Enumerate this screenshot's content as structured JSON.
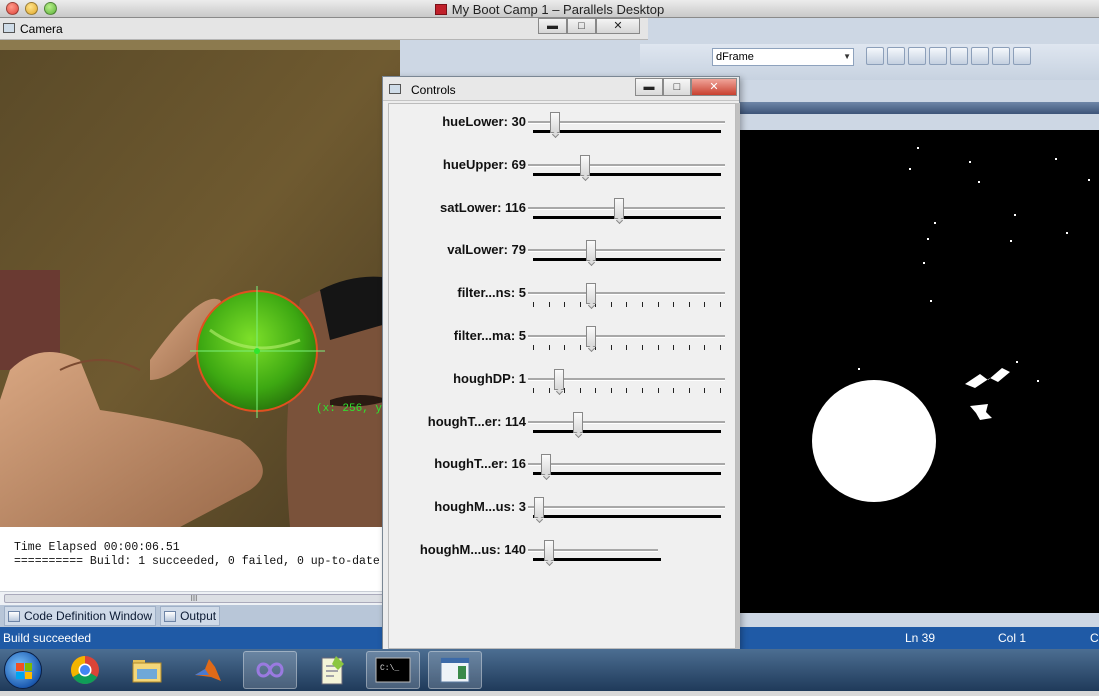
{
  "mac_window": {
    "title": "My Boot Camp 1 – Parallels Desktop"
  },
  "camera_window": {
    "title": "Camera",
    "tracking_label": "(x: 256, y"
  },
  "controls_window": {
    "title": "Controls",
    "trackbars": [
      {
        "label": "hueLower: 30",
        "fraction": 0.12,
        "ticks": false,
        "short": false
      },
      {
        "label": "hueUpper: 69",
        "fraction": 0.28,
        "ticks": false,
        "short": false
      },
      {
        "label": "satLower: 116",
        "fraction": 0.46,
        "ticks": false,
        "short": false
      },
      {
        "label": "valLower: 79",
        "fraction": 0.31,
        "ticks": false,
        "short": false
      },
      {
        "label": "filter...ns: 5",
        "fraction": 0.31,
        "ticks": true,
        "short": false
      },
      {
        "label": "filter...ma: 5",
        "fraction": 0.31,
        "ticks": true,
        "short": false
      },
      {
        "label": "houghDP: 1",
        "fraction": 0.14,
        "ticks": true,
        "short": false
      },
      {
        "label": "houghT...er: 114",
        "fraction": 0.24,
        "ticks": false,
        "short": false
      },
      {
        "label": "houghT...er: 16",
        "fraction": 0.07,
        "ticks": false,
        "short": false
      },
      {
        "label": "houghM...us: 3",
        "fraction": 0.03,
        "ticks": false,
        "short": false
      },
      {
        "label": "houghM...us: 140",
        "fraction": 0.13,
        "ticks": false,
        "short": true
      }
    ]
  },
  "ide": {
    "combo_text": "dFrame",
    "output_lines": [
      "Time Elapsed 00:00:06.51",
      "========== Build: 1 succeeded, 0 failed, 0 up-to-date"
    ],
    "scroll_grip": "III",
    "bottom_tabs": [
      "Code Definition Window",
      "Output"
    ],
    "status_left": "Build succeeded",
    "status_ln": "Ln 39",
    "status_col": "Col 1",
    "status_ch": "C"
  },
  "taskbar": {
    "items": [
      "start-orb",
      "chrome",
      "explorer",
      "matlab",
      "visual-studio",
      "notepad-plus-plus",
      "command-prompt",
      "app-window"
    ],
    "cmd_icon_text": "C:\\_"
  },
  "colors": {
    "status_blue": "#1f5aa6",
    "tracking_green": "#2ee62e",
    "ball_edge": "#e05020"
  }
}
